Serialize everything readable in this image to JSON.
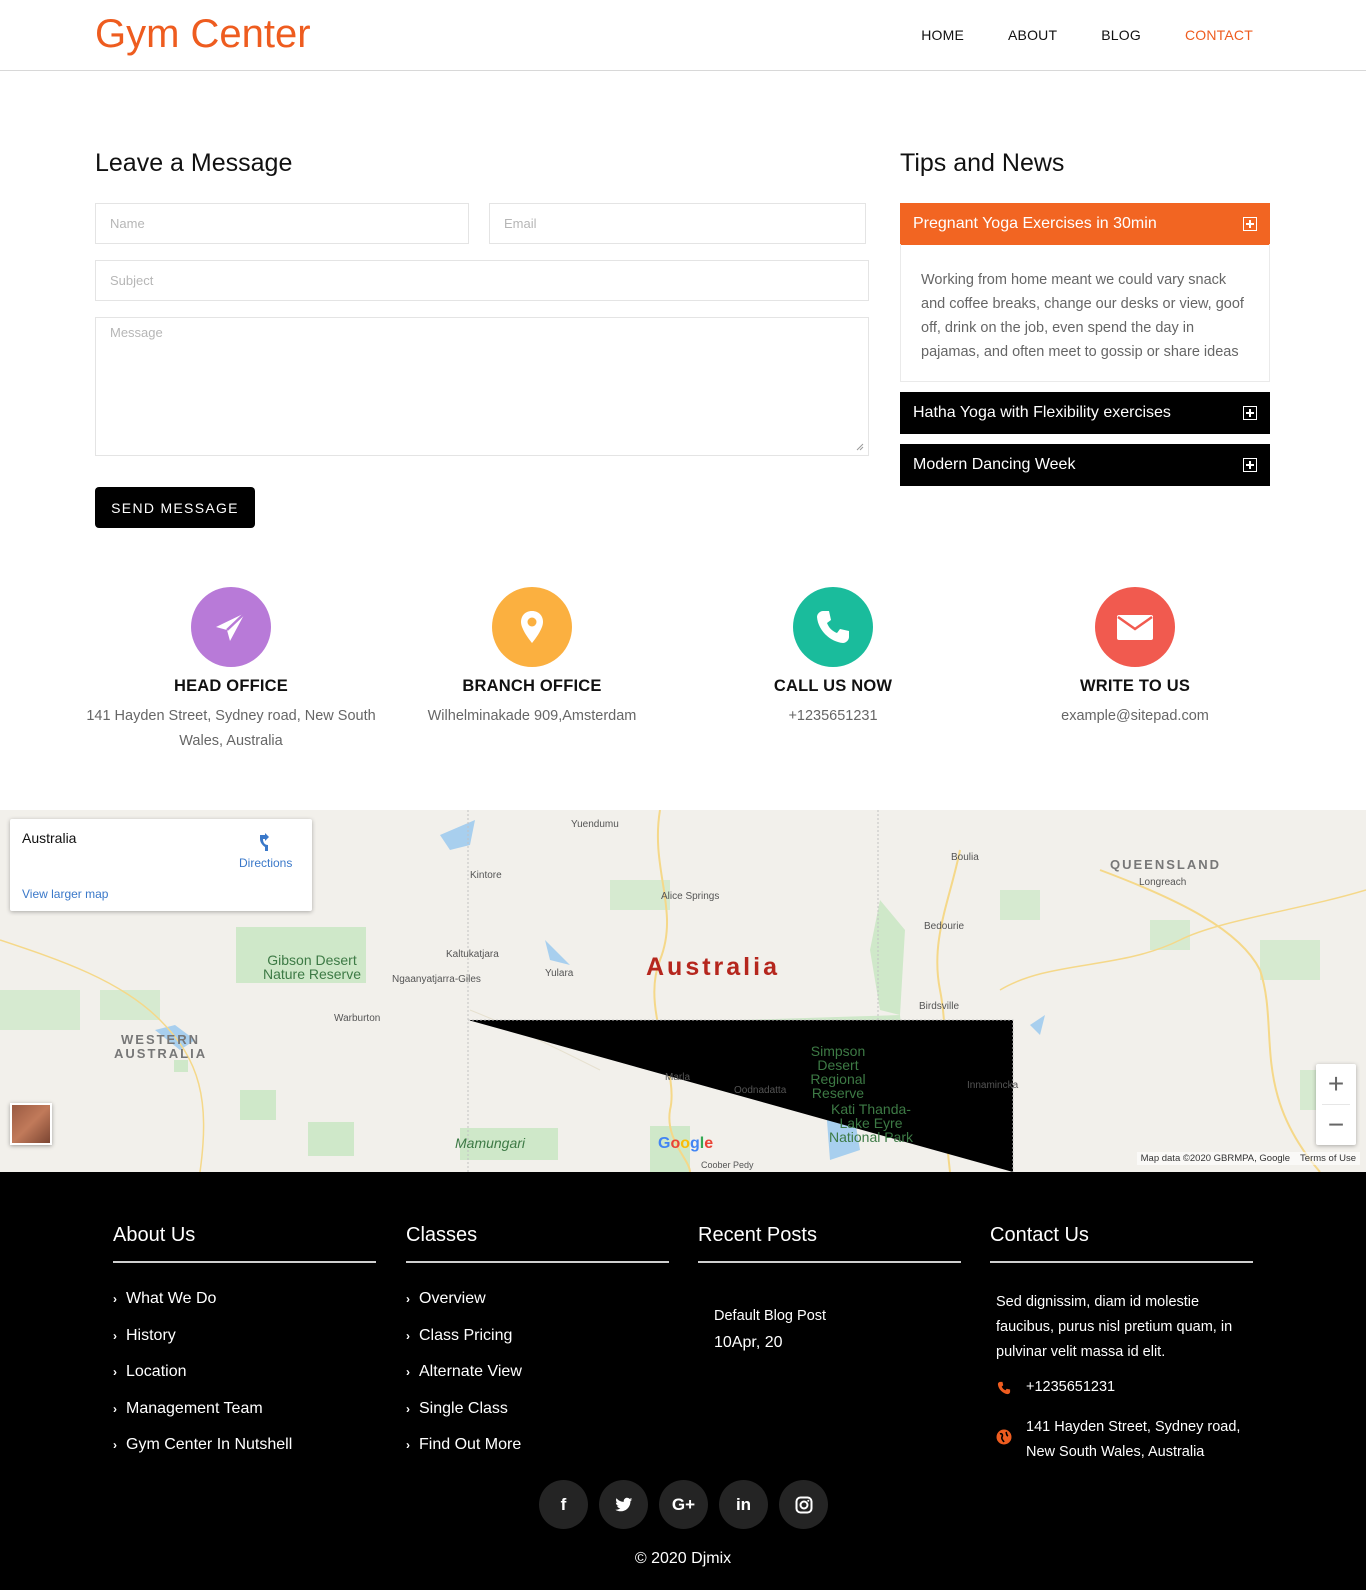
{
  "header": {
    "logo": "Gym Center",
    "nav": [
      "HOME",
      "ABOUT",
      "BLOG",
      "CONTACT"
    ],
    "active_nav": "CONTACT"
  },
  "form": {
    "title": "Leave a Message",
    "name_placeholder": "Name",
    "email_placeholder": "Email",
    "subject_placeholder": "Subject",
    "message_placeholder": "Message",
    "send_label": "SEND MESSAGE"
  },
  "tips": {
    "title": "Tips and News",
    "items": [
      {
        "title": "Pregnant Yoga Exercises in 30min",
        "body": "Working from home meant we could vary snack and coffee breaks, change our desks or view, goof off, drink on the job, even spend the day in pajamas, and often meet to gossip or share ideas",
        "open": true
      },
      {
        "title": "Hatha Yoga with Flexibility exercises",
        "open": false
      },
      {
        "title": "Modern Dancing Week",
        "open": false
      }
    ]
  },
  "contact_info": [
    {
      "label": "HEAD OFFICE",
      "text": "141 Hayden Street, Sydney road, New South Wales, Australia",
      "icon": "paper-plane-icon",
      "color": "#b87ad8"
    },
    {
      "label": "BRANCH OFFICE",
      "text": "Wilhelminakade 909,Amsterdam",
      "icon": "map-pin-icon",
      "color": "#fbb040"
    },
    {
      "label": "CALL US NOW",
      "text": "+1235651231",
      "icon": "phone-icon",
      "color": "#1abc9c"
    },
    {
      "label": "WRITE TO US",
      "text": "example@sitepad.com",
      "icon": "envelope-icon",
      "color": "#f15a4f"
    }
  ],
  "map": {
    "place": "Australia",
    "directions": "Directions",
    "view_larger": "View larger map",
    "country_label": "Australia",
    "labels": {
      "yuendumu": "Yuendumu",
      "kintore": "Kintore",
      "alice": "Alice Springs",
      "boulia": "Boulia",
      "queensland": "QUEENSLAND",
      "longreach": "Longreach",
      "bedourie": "Bedourie",
      "kaltukatjara": "Kaltukatjara",
      "ngaanyatjarra": "Ngaanyatjarra-Giles",
      "yulara": "Yulara",
      "gibson": "Gibson Desert Nature Reserve",
      "warburton": "Warburton",
      "birdsville": "Birdsville",
      "wa1": "WESTERN",
      "wa2": "AUSTRALIA",
      "simpson": "Simpson Desert Regional Reserve",
      "innamincka": "Innamincka",
      "marla": "Marla",
      "oodnadatta": "Oodnadatta",
      "kati": "Kati Thanda-Lake Eyre National Park",
      "mamungari": "Mamungari",
      "coober": "Coober Pedy"
    },
    "attribution": "Map data ©2020 GBRMPA, Google",
    "terms": "Terms of Use",
    "zoom_in": "+",
    "zoom_out": "−",
    "google": "Google"
  },
  "footer": {
    "about": {
      "title": "About Us",
      "items": [
        "What We Do",
        "History",
        "Location",
        "Management Team",
        "Gym Center In Nutshell"
      ]
    },
    "classes": {
      "title": "Classes",
      "items": [
        "Overview",
        "Class Pricing",
        "Alternate View",
        "Single Class",
        "Find Out More"
      ]
    },
    "recent": {
      "title": "Recent Posts",
      "post_title": "Default Blog Post",
      "post_date": "10Apr, 20"
    },
    "contact": {
      "title": "Contact Us",
      "desc": "Sed dignissim, diam id molestie faucibus, purus nisl pretium quam, in pulvinar velit massa id elit.",
      "phone": "+1235651231",
      "address": "141 Hayden Street, Sydney road, New South Wales, Australia"
    },
    "socials": [
      {
        "icon": "facebook-icon",
        "glyph": "f"
      },
      {
        "icon": "twitter-icon",
        "glyph": ""
      },
      {
        "icon": "google-plus-icon",
        "glyph": "G+"
      },
      {
        "icon": "linkedin-icon",
        "glyph": "in"
      },
      {
        "icon": "instagram-icon",
        "glyph": ""
      }
    ],
    "copyright": "© 2020 Djmix"
  },
  "colors": {
    "accent": "#ee5c1f",
    "tab_open": "#f26522"
  }
}
